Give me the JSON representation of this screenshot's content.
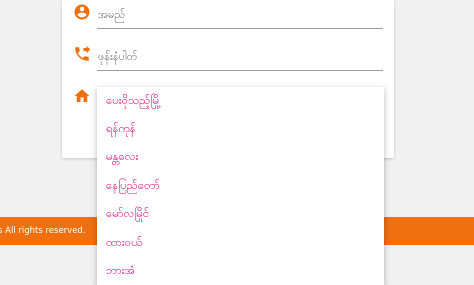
{
  "form": {
    "name_placeholder": "အမည်",
    "phone_placeholder": "ဖုန်းနံပါတ်"
  },
  "footer": {
    "text": "s All rights reserved."
  },
  "dropdown": {
    "options": [
      "ပေးဝိုသည့်မြို့",
      "ရန်ကုန်",
      "မန္တလေး",
      "နေပြည်တော်",
      "မော်လမြိုင်",
      "ထားဝယ်",
      "ဘားအံ"
    ]
  },
  "colors": {
    "accent": "#f07010",
    "option_text": "#e0127a"
  },
  "icons": [
    "account-circle-icon",
    "phone-forward-icon",
    "home-icon"
  ]
}
